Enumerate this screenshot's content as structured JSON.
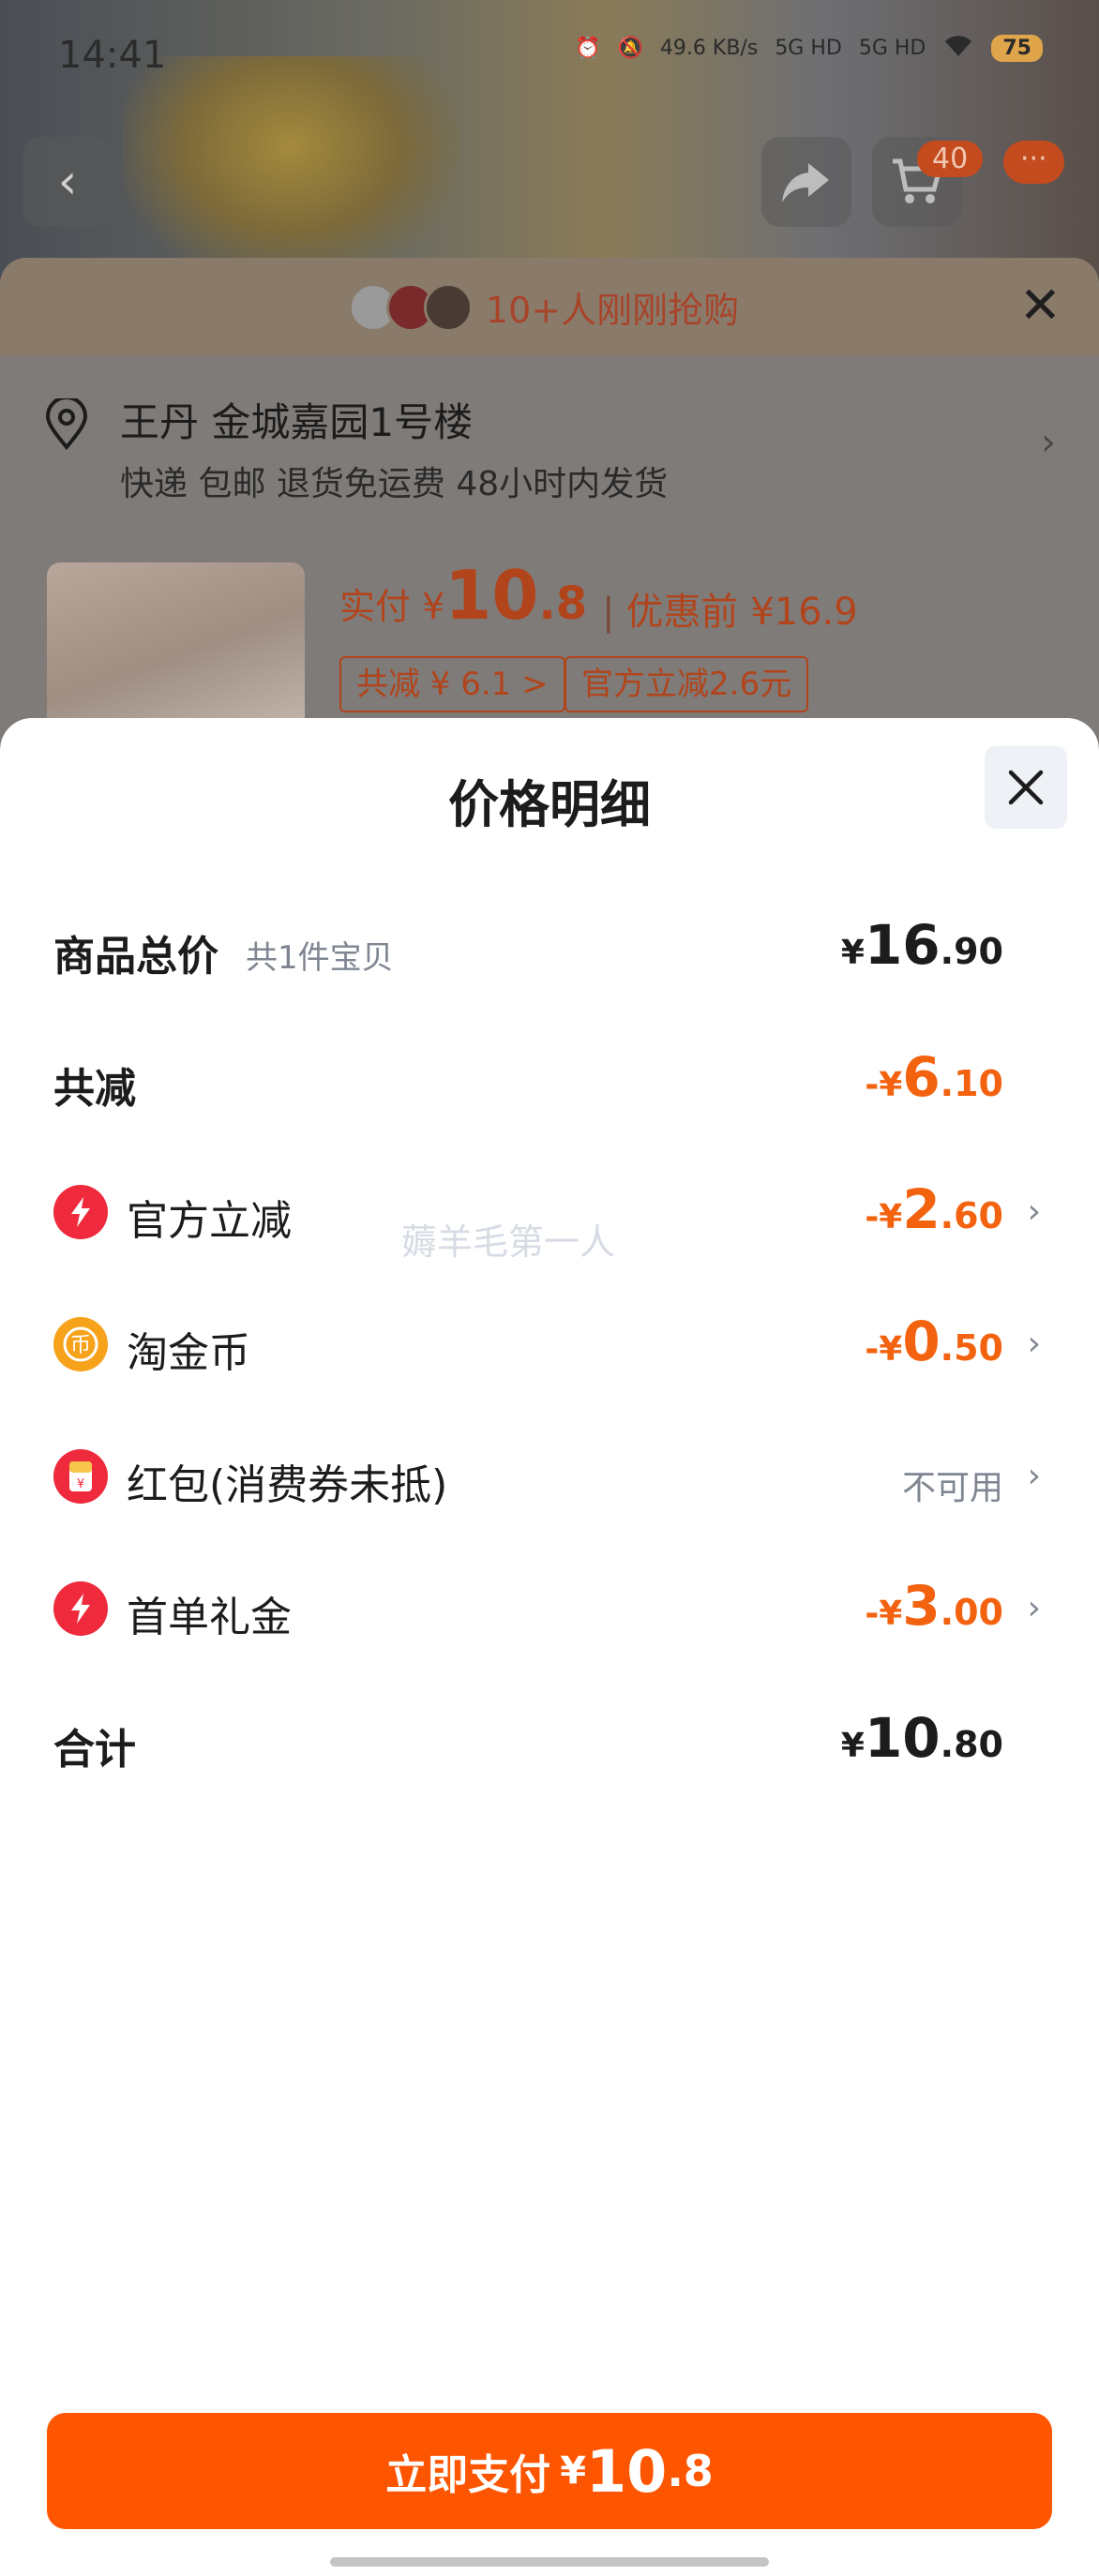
{
  "status_bar": {
    "time": "14:41",
    "net_speed": "49.6 KB/s",
    "signal_1": "5G HD",
    "signal_2": "5G HD",
    "battery": "75"
  },
  "top_nav": {
    "cart_count": "40",
    "more_label": "···"
  },
  "order_sheet": {
    "buyers_text": "10+人刚刚抢购",
    "address_name": "王丹 金城嘉园1号楼",
    "address_sub": "快递 包邮 退货免运费 48小时内发货",
    "real_price_label": "实付 ¥",
    "real_price_int": "10",
    "real_price_dec": ".8",
    "pre_price": "优惠前 ¥16.9",
    "chip_discount": "共减 ¥ 6.1 >",
    "chip_official": "官方立减2.6元"
  },
  "modal": {
    "title": "价格明细",
    "rows": [
      {
        "label": "商品总价",
        "sub": "共1件宝贝",
        "sym": "¥",
        "int": "16",
        "dec": ".90"
      },
      {
        "label": "共减",
        "sym": "-¥",
        "int": "6",
        "dec": ".10"
      },
      {
        "label": "官方立减",
        "icon": "lightning-icon",
        "sym": "-¥",
        "int": "2",
        "dec": ".60"
      },
      {
        "label": "淘金币",
        "icon": "coin-icon",
        "sym": "-¥",
        "int": "0",
        "dec": ".50"
      },
      {
        "label": "红包(消费券未抵)",
        "icon": "red-packet-icon",
        "status": "不可用"
      },
      {
        "label": "首单礼金",
        "icon": "lightning-icon",
        "sym": "-¥",
        "int": "3",
        "dec": ".00"
      },
      {
        "label": "合计",
        "sym": "¥",
        "int": "10",
        "dec": ".80"
      }
    ],
    "watermark": "薅羊毛第一人"
  },
  "pay_button": {
    "label": "立即支付",
    "sym": "¥",
    "int": "10",
    "dec": ".8"
  },
  "colors": {
    "accent_orange": "#fd5500",
    "discount_orange": "#f3620f",
    "icon_red": "#ee2a3c",
    "coin_gold": "#f7a21b"
  }
}
